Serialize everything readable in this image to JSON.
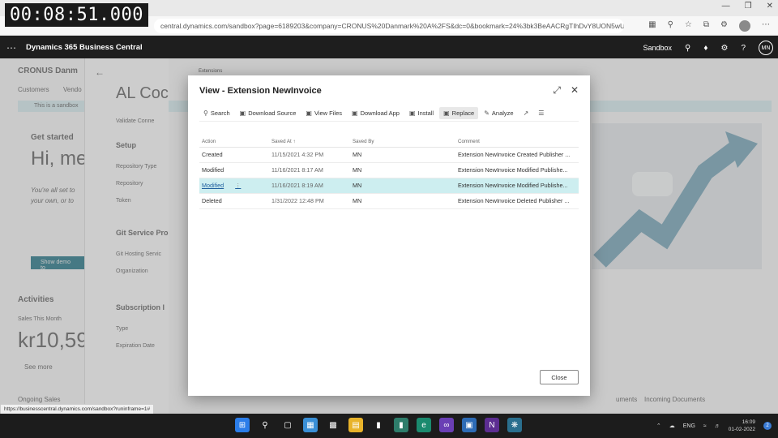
{
  "timer": "00:08:51.000",
  "browser": {
    "url": "central.dynamics.com/sandbox?page=6189203&company=CRONUS%20Danmark%20A%2FS&dc=0&bookmark=24%3bk3BeAACRgTIhDvY8UON5wU..."
  },
  "bc": {
    "app_title": "Dynamics 365 Business Central",
    "environment": "Sandbox",
    "user_initials": "MN"
  },
  "background": {
    "company": "CRONUS Danm",
    "nav_customers": "Customers",
    "nav_vendors": "Vendo",
    "sandbox_notice": "This is a sandbox",
    "get_started": "Get started",
    "greeting": "Hi, me",
    "intro_1": "You're all set to",
    "intro_2": "your own, or to",
    "show_demo": "Show demo to",
    "activities": "Activities",
    "sales_this_month": "Sales This Month",
    "sales_value": "kr10,59",
    "see_more": "See more",
    "ongoing_sales": "Ongoing Sales",
    "panel_title": "AL Coc",
    "validate_conn": "Validate Conne",
    "setup": "Setup",
    "repo_type": "Repository Type",
    "repository": "Repository",
    "token": "Token",
    "git_service": "Git Service Pro",
    "git_hosting": "Git Hosting Servic",
    "organization": "Organization",
    "subscription": "Subscription I",
    "type": "Type",
    "expiration": "Expiration Date",
    "extensions_crumb": "Extensions",
    "documents": "uments",
    "incoming_documents": "Incoming Documents"
  },
  "dialog": {
    "title": "View - Extension NewInvoice",
    "toolbar": [
      "Search",
      "Download Source",
      "View Files",
      "Download App",
      "Install",
      "Replace",
      "Analyze"
    ],
    "columns": [
      "Action",
      "Saved At ↑",
      "Saved By",
      "Comment"
    ],
    "rows": [
      {
        "action": "Created",
        "saved_at": "11/15/2021 4:32 PM",
        "saved_by": "MN",
        "comment": "Extension NewInvoice Created Publisher ..."
      },
      {
        "action": "Modified",
        "saved_at": "11/16/2021 8:17 AM",
        "saved_by": "MN",
        "comment": "Extension NewInvoice Modified Publishe..."
      },
      {
        "action": "Modified",
        "saved_at": "11/16/2021 8:19 AM",
        "saved_by": "MN",
        "comment": "Extension NewInvoice Modified Publishe..."
      },
      {
        "action": "Deleted",
        "saved_at": "1/31/2022 12:48 PM",
        "saved_by": "MN",
        "comment": "Extension NewInvoice Deleted Publisher ..."
      }
    ],
    "selected_row": 2,
    "close_label": "Close"
  },
  "status_url": "https://businesscentral.dynamics.com/sandbox?runinframe=1#",
  "taskbar": {
    "lang": "ENG",
    "time": "16:09",
    "date": "01-02-2022",
    "notifications": "2"
  }
}
